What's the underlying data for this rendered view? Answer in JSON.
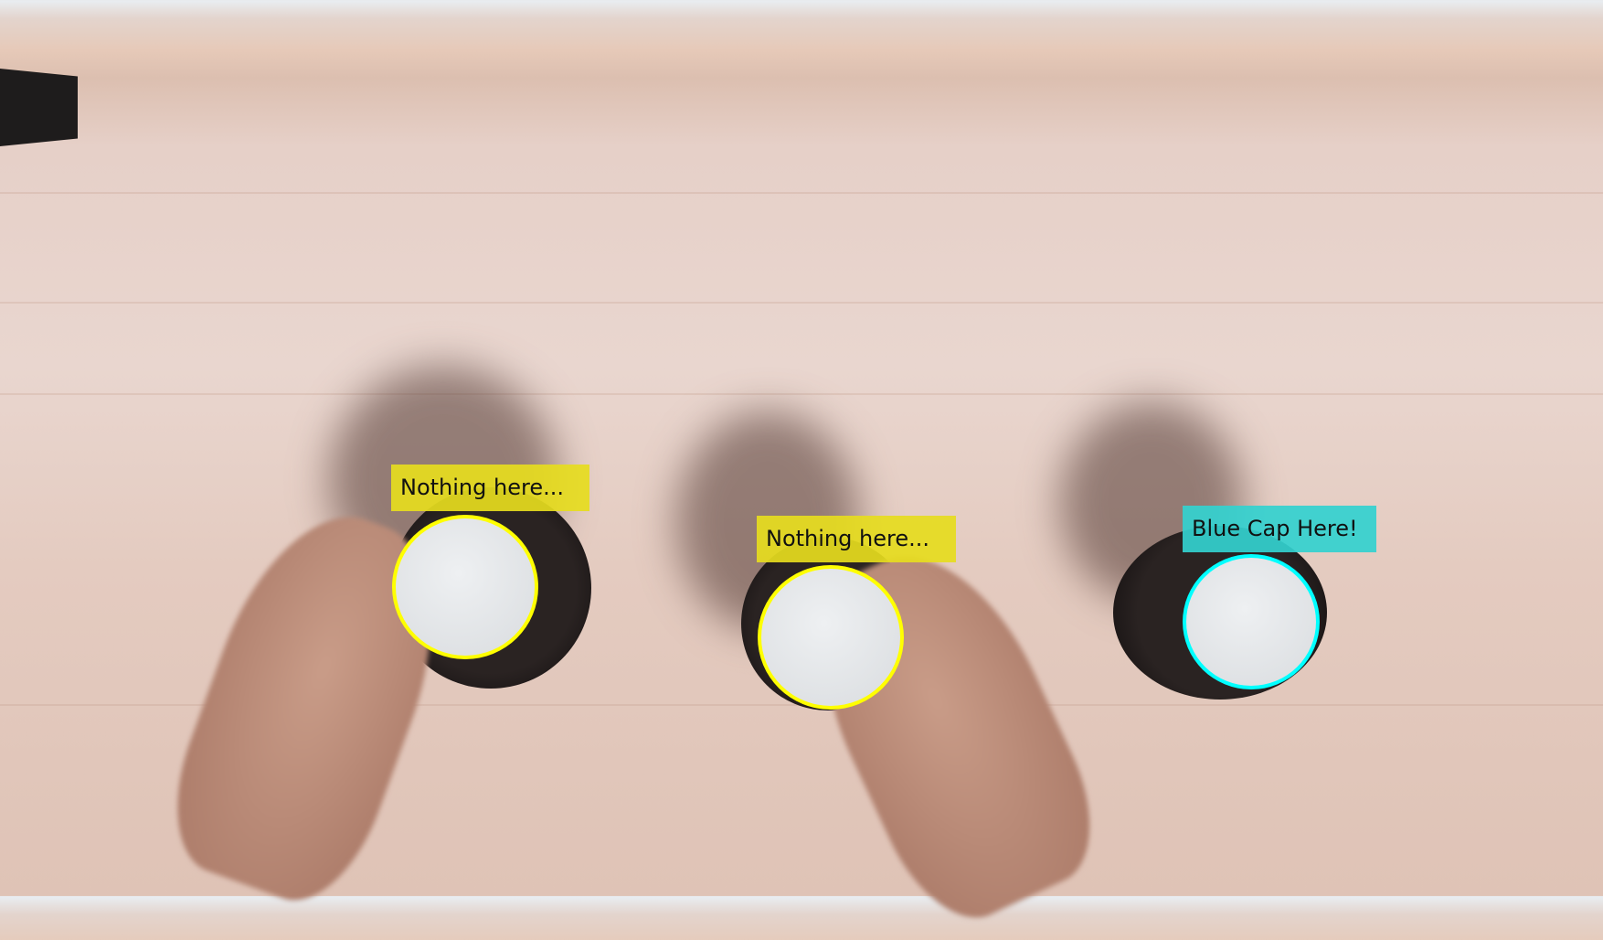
{
  "detections": [
    {
      "label": "Nothing here...",
      "color": "#e6dc1e",
      "ring_color": "#ffff00"
    },
    {
      "label": "Nothing here...",
      "color": "#e6dc1e",
      "ring_color": "#ffff00"
    },
    {
      "label": "Blue Cap Here!",
      "color": "#33d1cf",
      "ring_color": "#00ffff"
    }
  ]
}
